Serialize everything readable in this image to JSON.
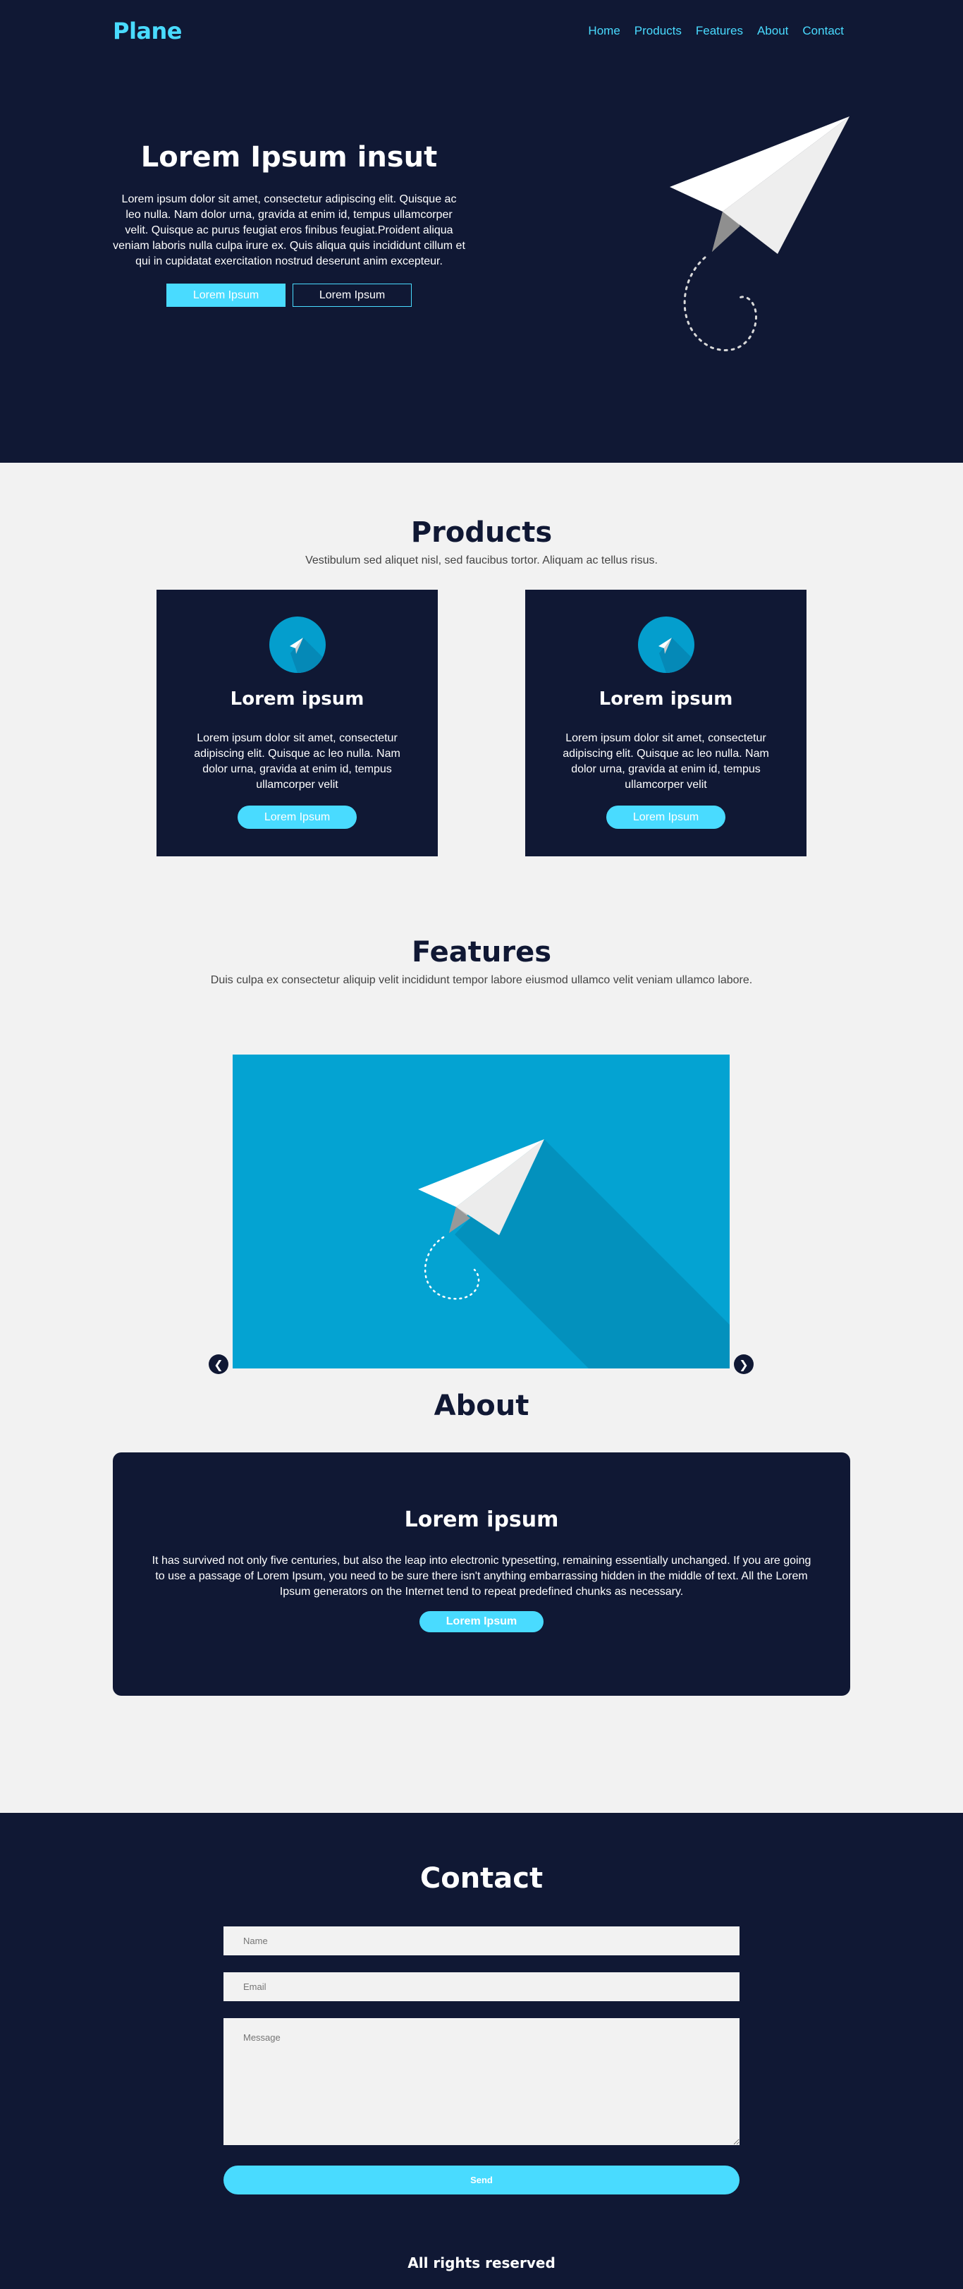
{
  "nav": {
    "logo": "Plane",
    "items": [
      "Home",
      "Products",
      "Features",
      "About",
      "Contact"
    ]
  },
  "hero": {
    "title": "Lorem Ipsum insut",
    "body": "Lorem ipsum dolor sit amet, consectetur adipiscing elit. Quisque ac leo nulla. Nam dolor urna, gravida at enim id, tempus ullamcorper velit. Quisque ac purus feugiat eros finibus feugiat.Proident aliqua veniam laboris nulla culpa irure ex. Quis aliqua quis incididunt cillum et qui in cupidatat exercitation nostrud deserunt anim excepteur.",
    "primary_button": "Lorem Ipsum",
    "secondary_button": "Lorem Ipsum",
    "illustration": "paper-plane-icon"
  },
  "products": {
    "title": "Products",
    "subtitle": "Vestibulum sed aliquet nisl, sed faucibus tortor. Aliquam ac tellus risus.",
    "cards": [
      {
        "icon": "paper-plane-icon",
        "title": "Lorem ipsum",
        "body": "Lorem ipsum dolor sit amet, consectetur adipiscing elit. Quisque ac leo nulla. Nam dolor urna, gravida at enim id, tempus ullamcorper velit",
        "button": "Lorem Ipsum"
      },
      {
        "icon": "paper-plane-icon",
        "title": "Lorem ipsum",
        "body": "Lorem ipsum dolor sit amet, consectetur adipiscing elit. Quisque ac leo nulla. Nam dolor urna, gravida at enim id, tempus ullamcorper velit",
        "button": "Lorem Ipsum"
      }
    ]
  },
  "features": {
    "title": "Features",
    "subtitle": "Duis culpa ex consectetur aliquip velit incididunt tempor labore eiusmod ullamco velit veniam ullamco labore.",
    "prev_icon": "chevron-left-icon",
    "next_icon": "chevron-right-icon"
  },
  "about": {
    "title": "About",
    "box_title": "Lorem ipsum",
    "box_body": "It has survived not only five centuries, but also the leap into electronic typesetting, remaining essentially unchanged. If you are going to use a passage of Lorem Ipsum, you need to be sure there isn't anything embarrassing hidden in the middle of text. All the Lorem Ipsum generators on the Internet tend to repeat predefined chunks as necessary.",
    "button": "Lorem Ipsum"
  },
  "contact": {
    "title": "Contact",
    "name_placeholder": "Name",
    "email_placeholder": "Email",
    "message_placeholder": "Message",
    "send_button": "Send"
  },
  "footer": {
    "text": "All rights reserved"
  },
  "colors": {
    "dark_navy": "#101834",
    "accent_cyan": "#49dbff",
    "light_bg": "#f2f2f2",
    "slider_blue": "#04a3d2"
  }
}
